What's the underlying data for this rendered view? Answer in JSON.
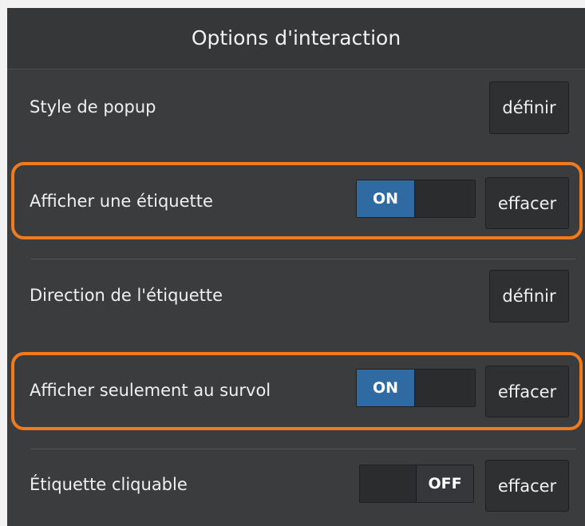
{
  "panel": {
    "title": "Options d'interaction"
  },
  "rows": [
    {
      "label": "Style de popup",
      "button": "définir"
    },
    {
      "label": "Afficher une étiquette",
      "toggle": "ON",
      "button": "effacer"
    },
    {
      "label": "Direction de l'étiquette",
      "button": "définir"
    },
    {
      "label": "Afficher seulement au survol",
      "toggle": "ON",
      "button": "effacer"
    },
    {
      "label": "Étiquette cliquable",
      "toggle": "OFF",
      "button": "effacer"
    }
  ],
  "colors": {
    "panel_bg": "#3a3c3e",
    "toggle_on": "#2f6aa3",
    "highlight": "#f07a1c"
  }
}
